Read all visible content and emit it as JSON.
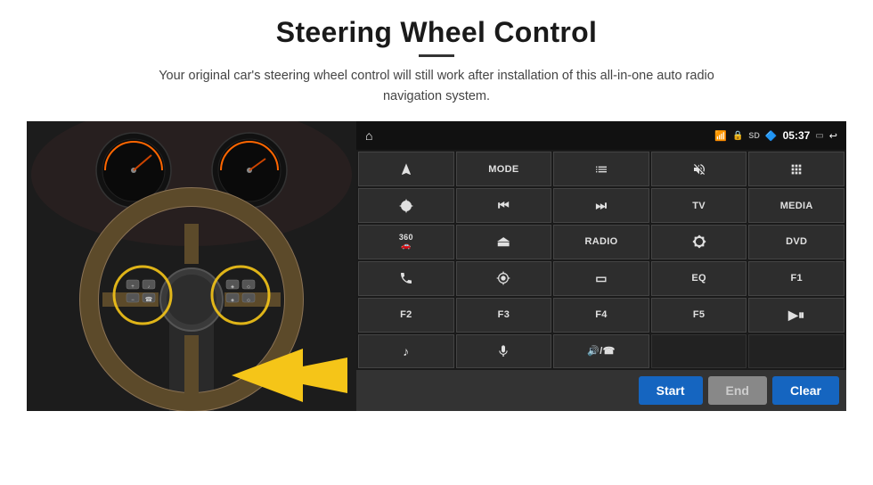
{
  "page": {
    "title": "Steering Wheel Control",
    "subtitle": "Your original car's steering wheel control will still work after installation of this all-in-one auto radio navigation system.",
    "divider": true
  },
  "status_bar": {
    "home_icon": "⌂",
    "time": "05:37",
    "wifi_icon": "wifi",
    "lock_icon": "lock",
    "sd_icon": "sd",
    "bt_icon": "bt",
    "screen_icon": "screen",
    "back_icon": "back"
  },
  "buttons": [
    {
      "id": "nav",
      "type": "icon",
      "icon": "nav",
      "row": 1,
      "col": 1
    },
    {
      "id": "mode",
      "type": "text",
      "label": "MODE",
      "row": 1,
      "col": 2
    },
    {
      "id": "list",
      "type": "icon",
      "icon": "list",
      "row": 1,
      "col": 3
    },
    {
      "id": "mute",
      "type": "icon",
      "icon": "mute",
      "row": 1,
      "col": 4
    },
    {
      "id": "apps",
      "type": "icon",
      "icon": "apps",
      "row": 1,
      "col": 5
    },
    {
      "id": "settings",
      "type": "icon",
      "icon": "settings",
      "row": 2,
      "col": 1
    },
    {
      "id": "prev",
      "type": "icon",
      "icon": "prev",
      "row": 2,
      "col": 2
    },
    {
      "id": "next",
      "type": "icon",
      "icon": "next",
      "row": 2,
      "col": 3
    },
    {
      "id": "tv",
      "type": "text",
      "label": "TV",
      "row": 2,
      "col": 4
    },
    {
      "id": "media",
      "type": "text",
      "label": "MEDIA",
      "row": 2,
      "col": 5
    },
    {
      "id": "360cam",
      "type": "icon",
      "icon": "360",
      "row": 3,
      "col": 1
    },
    {
      "id": "eject",
      "type": "icon",
      "icon": "eject",
      "row": 3,
      "col": 2
    },
    {
      "id": "radio",
      "type": "text",
      "label": "RADIO",
      "row": 3,
      "col": 3
    },
    {
      "id": "brightness",
      "type": "icon",
      "icon": "brightness",
      "row": 3,
      "col": 4
    },
    {
      "id": "dvd",
      "type": "text",
      "label": "DVD",
      "row": 3,
      "col": 5
    },
    {
      "id": "phone",
      "type": "icon",
      "icon": "phone",
      "row": 4,
      "col": 1
    },
    {
      "id": "gps",
      "type": "icon",
      "icon": "gps",
      "row": 4,
      "col": 2
    },
    {
      "id": "screen_mirror",
      "type": "icon",
      "icon": "screen_mirror",
      "row": 4,
      "col": 3
    },
    {
      "id": "eq",
      "type": "text",
      "label": "EQ",
      "row": 4,
      "col": 4
    },
    {
      "id": "f1",
      "type": "text",
      "label": "F1",
      "row": 4,
      "col": 5
    },
    {
      "id": "f2",
      "type": "text",
      "label": "F2",
      "row": 5,
      "col": 1
    },
    {
      "id": "f3",
      "type": "text",
      "label": "F3",
      "row": 5,
      "col": 2
    },
    {
      "id": "f4",
      "type": "text",
      "label": "F4",
      "row": 5,
      "col": 3
    },
    {
      "id": "f5",
      "type": "text",
      "label": "F5",
      "row": 5,
      "col": 4
    },
    {
      "id": "playpause",
      "type": "icon",
      "icon": "playpause",
      "row": 5,
      "col": 5
    },
    {
      "id": "music",
      "type": "icon",
      "icon": "music",
      "row": 6,
      "col": 1
    },
    {
      "id": "mic",
      "type": "icon",
      "icon": "mic",
      "row": 6,
      "col": 2
    },
    {
      "id": "vol_call",
      "type": "icon",
      "icon": "vol_call",
      "row": 6,
      "col": 3
    },
    {
      "id": "empty1",
      "type": "empty",
      "row": 6,
      "col": 4
    },
    {
      "id": "empty2",
      "type": "empty",
      "row": 6,
      "col": 5
    }
  ],
  "action_bar": {
    "start_label": "Start",
    "end_label": "End",
    "clear_label": "Clear"
  }
}
